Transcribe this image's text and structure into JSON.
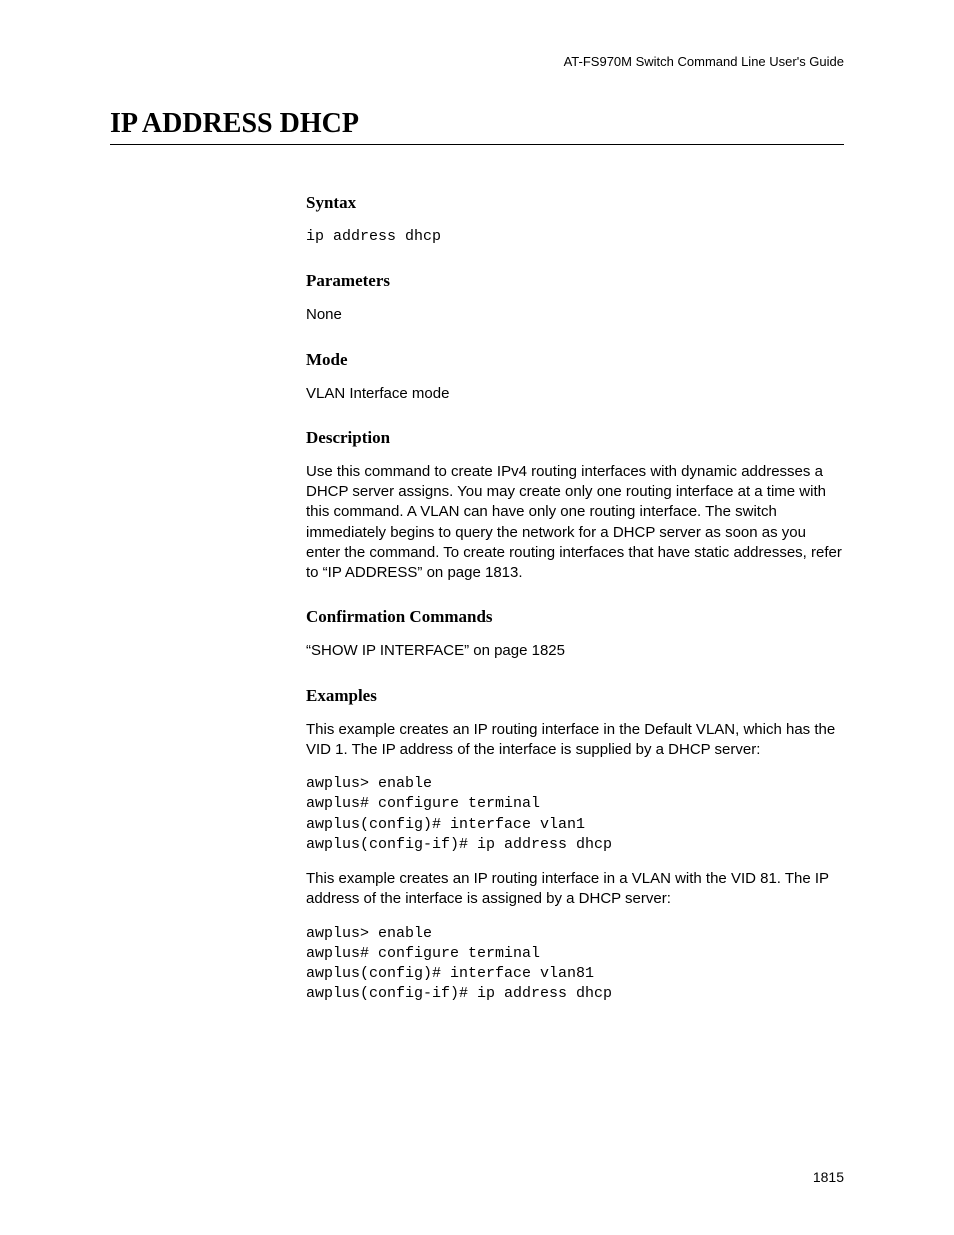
{
  "header": {
    "doc_title": "AT-FS970M Switch Command Line User's Guide"
  },
  "page": {
    "title": "IP ADDRESS DHCP",
    "number": "1815"
  },
  "sections": {
    "syntax": {
      "heading": "Syntax",
      "code": "ip address dhcp"
    },
    "parameters": {
      "heading": "Parameters",
      "text": "None"
    },
    "mode": {
      "heading": "Mode",
      "text": "VLAN Interface mode"
    },
    "description": {
      "heading": "Description",
      "text": "Use this command to create IPv4 routing interfaces with dynamic addresses a DHCP server assigns. You may create only one routing interface at a time with this command. A VLAN can have only one routing interface. The switch immediately begins to query the network for a DHCP server as soon as you enter the command. To create routing interfaces that have static addresses, refer to “IP ADDRESS” on page 1813."
    },
    "confirmation": {
      "heading": "Confirmation Commands",
      "text": "“SHOW IP INTERFACE” on page 1825"
    },
    "examples": {
      "heading": "Examples",
      "intro1": "This example creates an IP routing interface in the Default VLAN, which has the VID 1. The IP address of the interface is supplied by a DHCP server:",
      "code1": "awplus> enable\nawplus# configure terminal\nawplus(config)# interface vlan1\nawplus(config-if)# ip address dhcp",
      "intro2": "This example creates an IP routing interface in a VLAN with the VID 81. The IP address of the interface is assigned by a DHCP server:",
      "code2": "awplus> enable\nawplus# configure terminal\nawplus(config)# interface vlan81\nawplus(config-if)# ip address dhcp"
    }
  }
}
